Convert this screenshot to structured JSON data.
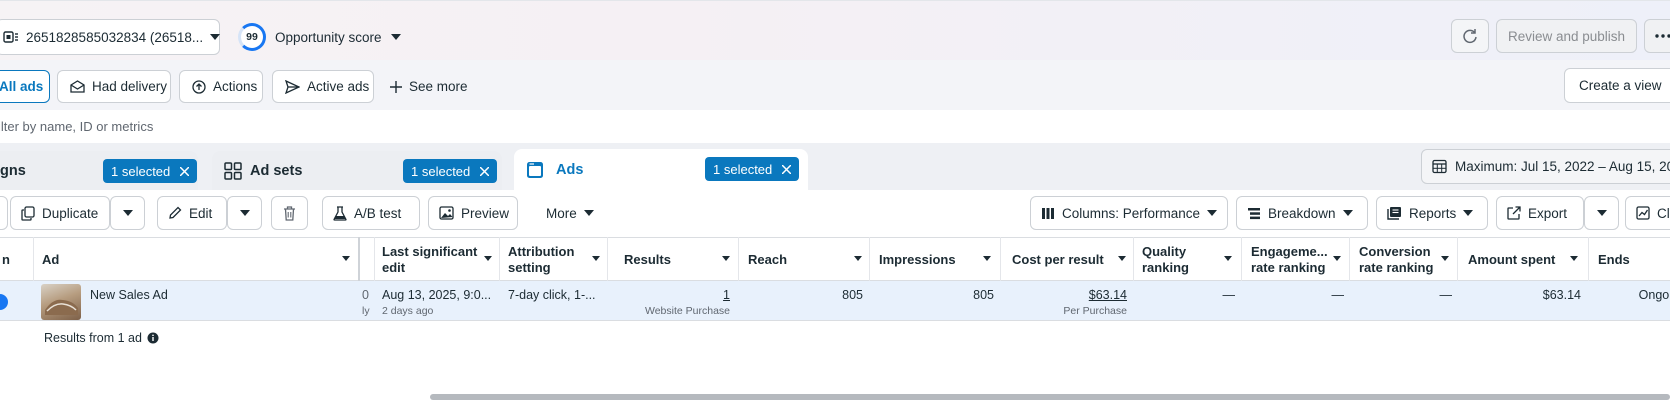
{
  "header": {
    "account_select": "2651828585032834 (26518...",
    "opportunity_score": "99",
    "opportunity_label": "Opportunity score",
    "review_publish": "Review and publish"
  },
  "filters": {
    "all_ads": "All ads",
    "had_delivery": "Had delivery",
    "actions": "Actions",
    "active_ads": "Active ads",
    "see_more": "See more",
    "create_view": "Create a view"
  },
  "search": {
    "placeholder": "ilter by name, ID or metrics"
  },
  "level_tabs": {
    "campaigns": "gns",
    "campaigns_selected": "1 selected",
    "adsets": "Ad sets",
    "adsets_selected": "1 selected",
    "ads": "Ads",
    "ads_selected": "1 selected",
    "date_range": "Maximum: Jul 15, 2022 – Aug 15, 202"
  },
  "toolbar": {
    "duplicate": "Duplicate",
    "edit": "Edit",
    "ab_test": "A/B test",
    "preview": "Preview",
    "more": "More",
    "columns": "Columns: Performance",
    "breakdown": "Breakdown",
    "reports": "Reports",
    "export": "Export",
    "chart_partial": "Cl"
  },
  "table": {
    "headers": {
      "first": "n",
      "ad": "Ad",
      "last_edit_1": "Last significant",
      "last_edit_2": "edit",
      "attribution_1": "Attribution",
      "attribution_2": "setting",
      "results": "Results",
      "reach": "Reach",
      "impressions": "Impressions",
      "cost_per_result": "Cost per result",
      "quality_1": "Quality",
      "quality_2": "ranking",
      "engagement_1": "Engageme...",
      "engagement_2": "rate ranking",
      "conversion_1": "Conversion",
      "conversion_2": "rate ranking",
      "amount_spent": "Amount spent",
      "ends": "Ends"
    },
    "row": {
      "ad_name": "New Sales Ad",
      "partial_top": "0",
      "partial_bottom": "ly",
      "last_edit": "Aug 13, 2025, 9:0...",
      "last_edit_sub": "2 days ago",
      "attribution": "7-day click, 1-...",
      "results": "1",
      "results_sub": "Website Purchase",
      "reach": "805",
      "impressions": "805",
      "cost_per_result": "$63.14",
      "cost_sub": "Per Purchase",
      "quality": "—",
      "engagement": "—",
      "conversion": "—",
      "amount_spent": "$63.14",
      "ends": "Ongoi"
    },
    "summary": "Results from 1 ad"
  },
  "colors": {
    "accent": "#0a78be",
    "selected_row": "#e8f1fc"
  }
}
